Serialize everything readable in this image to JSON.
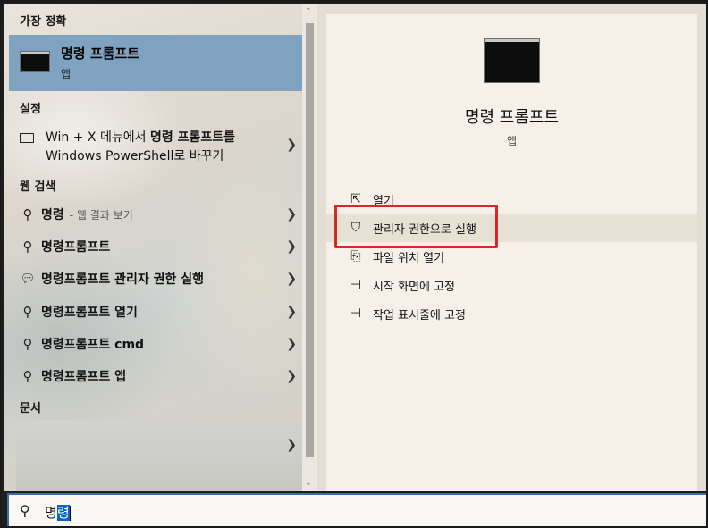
{
  "left": {
    "best_match_header": "가장 정확",
    "best_match": {
      "title": "명령 프롬프트",
      "subtitle": "앱"
    },
    "settings_header": "설정",
    "setting": {
      "line1_pre": "Win + X 메뉴에서 ",
      "line1_bold": "명령",
      "line1_post": " 프롬프트를",
      "line2": "Windows PowerShell로 바꾸기"
    },
    "web_header": "웹 검색",
    "web_items": [
      {
        "icon": "search-icon",
        "label_bold": "명령",
        "hint": "- 웹 결과 보기"
      },
      {
        "icon": "search-icon",
        "label_bold": "명령",
        "label_light": "프롬프트",
        "label_tail": ""
      },
      {
        "icon": "chat-icon",
        "label_bold": "명령",
        "label_light": "프롬프트 관리자 권한 실행",
        "label_tail": ""
      },
      {
        "icon": "search-icon",
        "label_bold": "명령",
        "label_light": "프롬프트 ",
        "label_tail": "열기"
      },
      {
        "icon": "search-icon",
        "label_bold": "명령",
        "label_light": "프롬프트 ",
        "label_tail": "cmd"
      },
      {
        "icon": "search-icon",
        "label_bold": "명령",
        "label_light": "프롬프트 ",
        "label_tail": "앱"
      }
    ],
    "docs_header": "문서"
  },
  "right": {
    "app_name": "명령 프롬프트",
    "app_type": "앱",
    "actions": [
      {
        "icon": "open-icon",
        "label": "열기"
      },
      {
        "icon": "shield-icon",
        "label": "관리자 권한으로 실행",
        "highlighted": true
      },
      {
        "icon": "file-location-icon",
        "label": "파일 위치 열기"
      },
      {
        "icon": "pin-icon",
        "label": "시작 화면에 고정"
      },
      {
        "icon": "pin-icon",
        "label": "작업 표시줄에 고정"
      }
    ]
  },
  "search": {
    "typed": "명",
    "selected": "령"
  },
  "colors": {
    "best_match_bg": "#7fa2c0",
    "highlight_box": "#d62828",
    "selection": "#0a64c2"
  }
}
